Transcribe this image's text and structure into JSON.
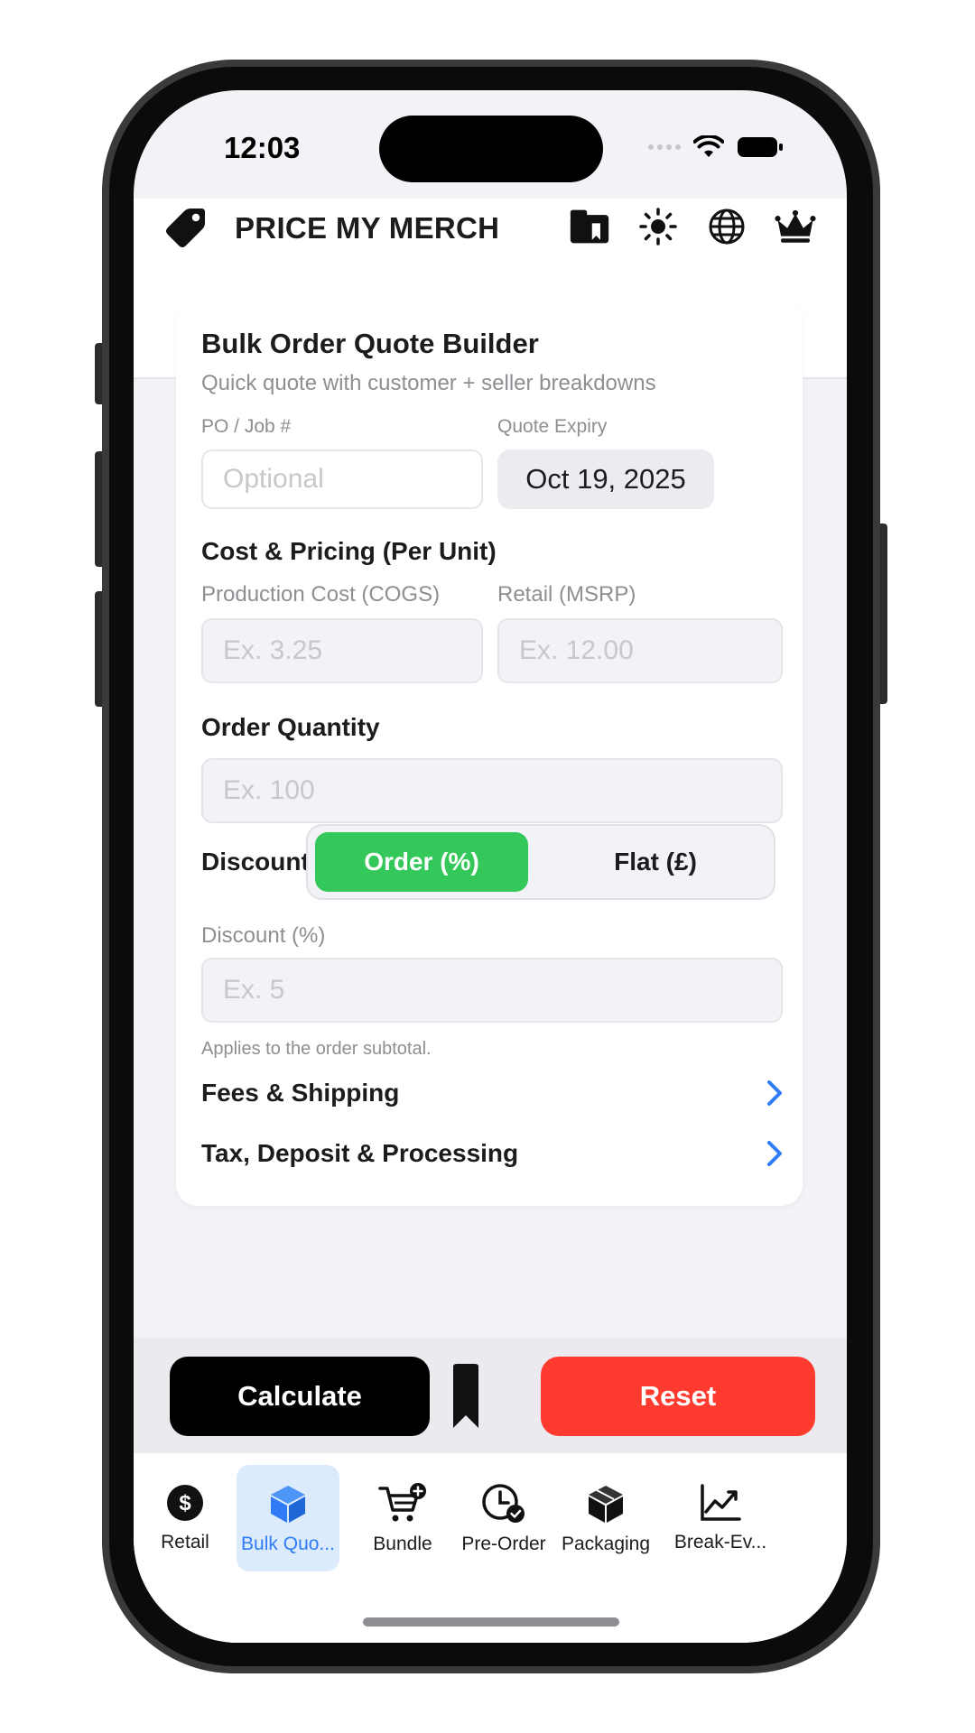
{
  "status_bar": {
    "time": "12:03"
  },
  "header": {
    "title": "PRICE MY MERCH"
  },
  "card": {
    "title": "Bulk Order Quote Builder",
    "subtitle": "Quick quote with customer + seller breakdowns",
    "po_label": "PO / Job #",
    "po_placeholder": "Optional",
    "expiry_label": "Quote Expiry",
    "expiry_value": "Oct 19, 2025",
    "cost_section_title": "Cost & Pricing (Per Unit)",
    "cogs_label": "Production Cost (COGS)",
    "cogs_placeholder": "Ex. 3.25",
    "msrp_label": "Retail (MSRP)",
    "msrp_placeholder": "Ex. 12.00",
    "quantity_title": "Order Quantity",
    "quantity_placeholder": "Ex. 100",
    "discount_title": "Discount",
    "discount_options": [
      "Order (%)",
      "Flat (£)"
    ],
    "discount_selected": "Order (%)",
    "discount_pct_label": "Discount (%)",
    "discount_placeholder": "Ex. 5",
    "discount_hint": "Applies to the order subtotal.",
    "fees_link": "Fees & Shipping",
    "tax_link": "Tax, Deposit & Processing"
  },
  "actions": {
    "calculate": "Calculate",
    "reset": "Reset"
  },
  "tabs": [
    {
      "label": "Retail",
      "icon": "dollar-circle-icon",
      "active": false
    },
    {
      "label": "Bulk Quo...",
      "icon": "cube-icon",
      "active": true
    },
    {
      "label": "Bundle",
      "icon": "cart-plus-icon",
      "active": false
    },
    {
      "label": "Pre-Order",
      "icon": "clock-check-icon",
      "active": false
    },
    {
      "label": "Packaging",
      "icon": "box-icon",
      "active": false
    },
    {
      "label": "Break-Ev...",
      "icon": "chart-line-icon",
      "active": false
    }
  ],
  "colors": {
    "accent_green": "#34c759",
    "reset_red": "#ff3b30",
    "tab_active_blue": "#2f7cf6",
    "chevron_blue": "#2f7cf6"
  }
}
